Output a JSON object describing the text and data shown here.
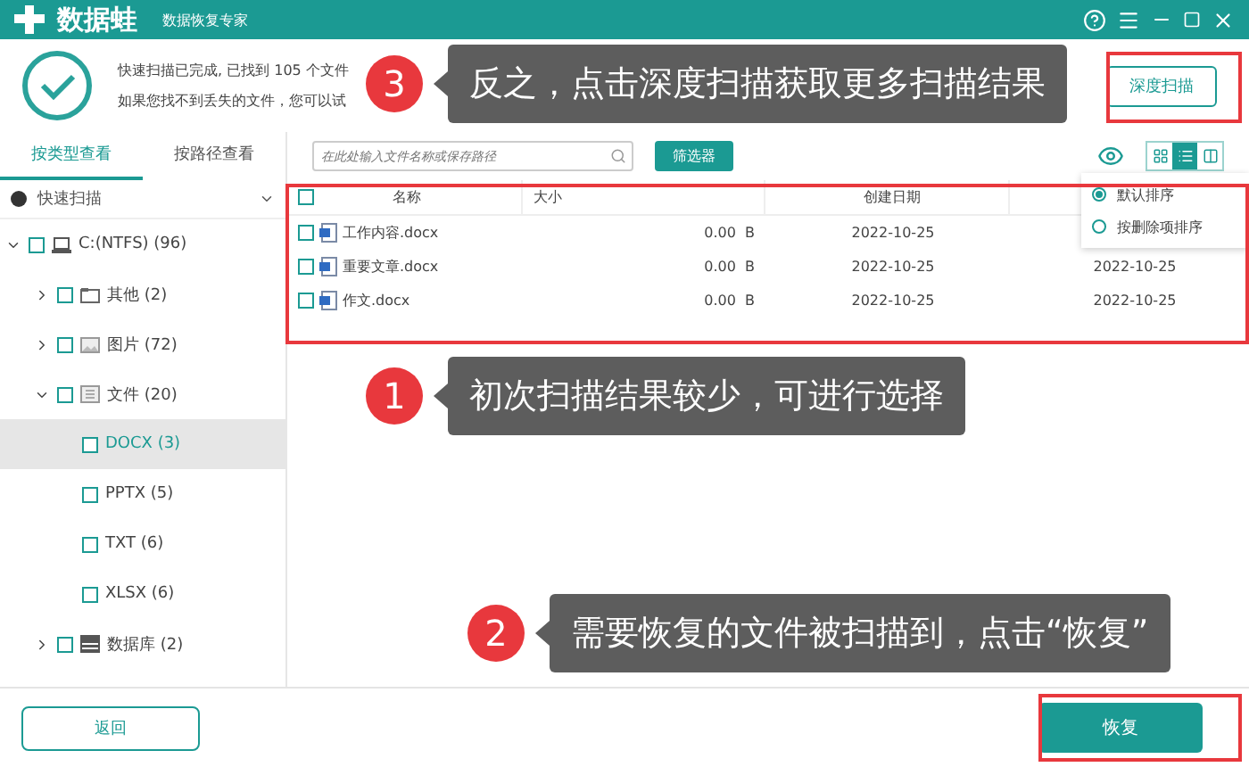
{
  "title_bar": {
    "app_name": "数据蛙",
    "subtitle": "数据恢复专家"
  },
  "scan_summary": {
    "line_1": "快速扫描已完成, 已找到 105 个文件",
    "line_2": "如果您找不到丢失的文件，您可以试"
  },
  "deep_scan_button": "深度扫描",
  "view_tabs": [
    {
      "label": "按类型查看",
      "selected": true
    },
    {
      "label": "按路径查看",
      "selected": false
    }
  ],
  "scan_selector": "快速扫描",
  "tree": [
    {
      "label": "C:(NTFS) (96)",
      "kind": "drive",
      "expanded": true,
      "selected": false,
      "checked": false,
      "children": [
        {
          "label": "其他 (2)",
          "kind": "folder",
          "expanded": false,
          "selected": false,
          "checked": false
        },
        {
          "label": "图片 (72)",
          "kind": "image",
          "expanded": false,
          "selected": false,
          "checked": false
        },
        {
          "label": "文件 (20)",
          "kind": "document",
          "expanded": true,
          "selected": false,
          "checked": false,
          "children": [
            {
              "label": "DOCX (3)",
              "selected": true,
              "checked": false
            },
            {
              "label": "PPTX (5)",
              "selected": false,
              "checked": false
            },
            {
              "label": "TXT (6)",
              "selected": false,
              "checked": false
            },
            {
              "label": "XLSX (6)",
              "selected": false,
              "checked": false
            }
          ]
        },
        {
          "label": "数据库 (2)",
          "kind": "database",
          "expanded": false,
          "selected": false,
          "checked": false
        }
      ]
    }
  ],
  "search": {
    "placeholder": "在此处输入文件名称或保存路径"
  },
  "filter_button": "筛选器",
  "view_modes": [
    {
      "kind": "grid",
      "selected": false
    },
    {
      "kind": "list",
      "selected": true
    },
    {
      "kind": "detail",
      "selected": false
    }
  ],
  "table": {
    "all_checked": false,
    "columns": [
      "名称",
      "大小",
      "创建日期"
    ],
    "rows": [
      {
        "name": "工作内容.docx",
        "size": "0.00  B",
        "created": "2022-10-25",
        "checked": false
      },
      {
        "name": "重要文章.docx",
        "size": "0.00  B",
        "created": "2022-10-25",
        "column_4": "2022-10-25",
        "checked": false
      },
      {
        "name": "作文.docx",
        "size": "0.00  B",
        "created": "2022-10-25",
        "column_4": "2022-10-25",
        "checked": false
      }
    ]
  },
  "sort_menu": [
    {
      "label": "默认排序",
      "selected": true
    },
    {
      "label": "按删除项排序",
      "selected": false
    }
  ],
  "footer": {
    "back_button": "返回",
    "recover_button": "恢复"
  },
  "callouts": [
    {
      "number": "3",
      "text": "反之，点击深度扫描获取更多扫描结果"
    },
    {
      "number": "1",
      "text": "初次扫描结果较少，可进行选择"
    },
    {
      "number": "2",
      "text": "需要恢复的文件被扫描到，点击“恢复”"
    }
  ]
}
